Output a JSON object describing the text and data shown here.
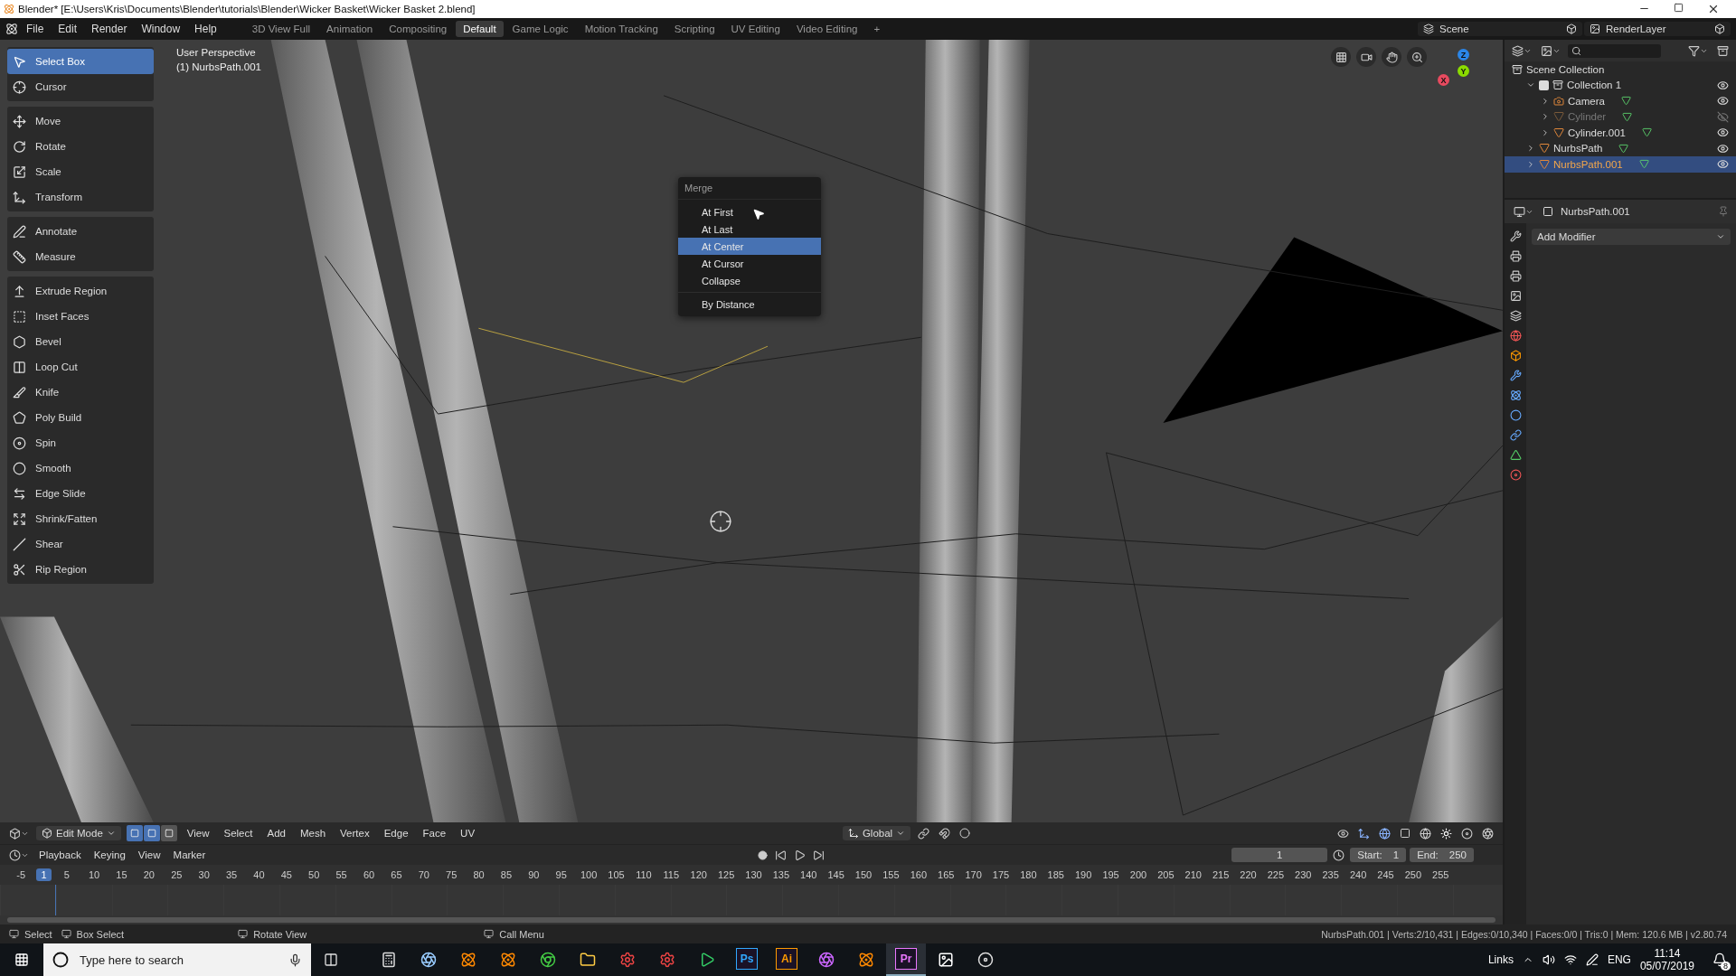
{
  "window": {
    "title": "Blender* [E:\\Users\\Kris\\Documents\\Blender\\tutorials\\Blender\\Wicker Basket\\Wicker Basket 2.blend]"
  },
  "menu_bar": [
    "File",
    "Edit",
    "Render",
    "Window",
    "Help"
  ],
  "workspaces": [
    {
      "label": "3D View Full",
      "selected": false
    },
    {
      "label": "Animation",
      "selected": false
    },
    {
      "label": "Compositing",
      "selected": false
    },
    {
      "label": "Default",
      "selected": true
    },
    {
      "label": "Game Logic",
      "selected": false
    },
    {
      "label": "Motion Tracking",
      "selected": false
    },
    {
      "label": "Scripting",
      "selected": false
    },
    {
      "label": "UV Editing",
      "selected": false
    },
    {
      "label": "Video Editing",
      "selected": false
    }
  ],
  "add_workspace": "+",
  "scene": "Scene",
  "view_layer": "RenderLayer",
  "viewport": {
    "view_name": "User Perspective",
    "object_label": "(1) NurbsPath.001",
    "gizmo_axes": [
      "X",
      "Y",
      "Z"
    ]
  },
  "toolbar": {
    "groups": [
      [
        {
          "label": "Select Box",
          "selected": true
        },
        {
          "label": "Cursor",
          "selected": false
        }
      ],
      [
        {
          "label": "Move",
          "selected": false
        },
        {
          "label": "Rotate",
          "selected": false
        },
        {
          "label": "Scale",
          "selected": false
        },
        {
          "label": "Transform",
          "selected": false
        }
      ],
      [
        {
          "label": "Annotate",
          "selected": false
        },
        {
          "label": "Measure",
          "selected": false
        }
      ],
      [
        {
          "label": "Extrude Region",
          "selected": false
        },
        {
          "label": "Inset Faces",
          "selected": false
        },
        {
          "label": "Bevel",
          "selected": false
        },
        {
          "label": "Loop Cut",
          "selected": false
        },
        {
          "label": "Knife",
          "selected": false
        },
        {
          "label": "Poly Build",
          "selected": false
        },
        {
          "label": "Spin",
          "selected": false
        },
        {
          "label": "Smooth",
          "selected": false
        },
        {
          "label": "Edge Slide",
          "selected": false
        },
        {
          "label": "Shrink/Fatten",
          "selected": false
        },
        {
          "label": "Shear",
          "selected": false
        },
        {
          "label": "Rip Region",
          "selected": false
        }
      ]
    ]
  },
  "merge_menu": {
    "title": "Merge",
    "sections": [
      [
        {
          "label": "At First",
          "selected": false
        },
        {
          "label": "At Last",
          "selected": false
        },
        {
          "label": "At Center",
          "selected": true
        },
        {
          "label": "At Cursor",
          "selected": false
        },
        {
          "label": "Collapse",
          "selected": false
        }
      ],
      [
        {
          "label": "By Distance",
          "selected": false
        }
      ]
    ]
  },
  "viewport_header": {
    "mode": "Edit Mode",
    "select_modes": [
      {
        "selected": true
      },
      {
        "selected": true
      },
      {
        "selected": false
      }
    ],
    "menus": [
      "View",
      "Select",
      "Add",
      "Mesh",
      "Vertex",
      "Edge",
      "Face",
      "UV"
    ],
    "orientation": "Global"
  },
  "outliner": {
    "root": "Scene Collection",
    "items": [
      {
        "label": "Collection 1",
        "kind": "collection",
        "checked": true,
        "expanded": true,
        "visible": true,
        "selected": false,
        "children": [
          {
            "label": "Camera",
            "kind": "camera",
            "expanded": false,
            "visible": true,
            "selected": false
          },
          {
            "label": "Cylinder",
            "kind": "mesh",
            "expanded": false,
            "visible": false,
            "selected": false
          },
          {
            "label": "Cylinder.001",
            "kind": "mesh",
            "expanded": false,
            "visible": true,
            "selected": false
          }
        ]
      },
      {
        "label": "NurbsPath",
        "kind": "mesh",
        "expanded": false,
        "visible": true,
        "selected": false
      },
      {
        "label": "NurbsPath.001",
        "kind": "mesh",
        "expanded": false,
        "visible": true,
        "selected": true
      }
    ]
  },
  "properties": {
    "object_name": "NurbsPath.001",
    "add_modifier": "Add Modifier"
  },
  "timeline": {
    "menus": [
      "Playback",
      "Keying",
      "View",
      "Marker"
    ],
    "current_frame": "1",
    "start_label": "Start:",
    "start": "1",
    "end_label": "End:",
    "end": "250",
    "playhead_frame": "1",
    "ruler": [
      "-5",
      "5",
      "10",
      "15",
      "20",
      "25",
      "30",
      "35",
      "40",
      "45",
      "50",
      "55",
      "60",
      "65",
      "70",
      "75",
      "80",
      "85",
      "90",
      "95",
      "100",
      "105",
      "110",
      "115",
      "120",
      "125",
      "130",
      "135",
      "140",
      "145",
      "150",
      "155",
      "160",
      "165",
      "170",
      "175",
      "180",
      "185",
      "190",
      "195",
      "200",
      "205",
      "210",
      "215",
      "220",
      "225",
      "230",
      "235",
      "240",
      "245",
      "250",
      "255"
    ]
  },
  "status_bar": {
    "hints": [
      "Select",
      "Box Select",
      "Rotate View",
      "Call Menu"
    ],
    "stats": "NurbsPath.001 | Verts:2/10,431 | Edges:0/10,340 | Faces:0/0 | Tris:0 | Mem: 120.6 MB | v2.80.74"
  },
  "taskbar": {
    "search_placeholder": "Type here to search",
    "badge_apps": [
      {
        "label": "Ps",
        "color": "#31a8ff",
        "selected": false
      },
      {
        "label": "Ai",
        "color": "#ff9a00",
        "selected": false
      },
      {
        "label": "Pr",
        "color": "#ea77ff",
        "selected": true
      }
    ],
    "tray_label": "Links",
    "language": "ENG",
    "time": "11:14",
    "date": "05/07/2019",
    "notifications": "8"
  }
}
